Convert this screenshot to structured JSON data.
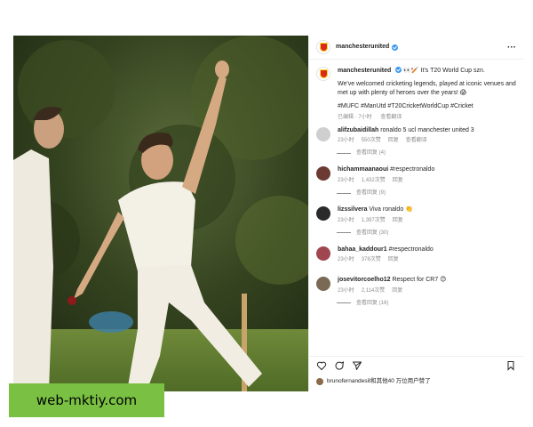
{
  "post": {
    "username": "manchesterunited",
    "more_label": "···"
  },
  "caption": {
    "username": "manchesterunited",
    "line1": "👀🏏 It's T20 World Cup szn.",
    "line2": "We've welcomed cricketing legends, played at iconic venues and met up with plenty of heroes over the years! 😱",
    "hashtags": "#MUFC #ManUtd #T20CricketWorldCup #Cricket",
    "edited": "已编辑 · 7小时",
    "see_translation": "查看翻译"
  },
  "comments": [
    {
      "username": "alifzubaidillah",
      "text": "ronaldo 5 ucl manchester united 3",
      "time": "23小时",
      "likes": "550次赞",
      "reply": "回复",
      "translate": "查看翻译",
      "replies": "查看回复 (4)",
      "avatar_color": "#cfcfcf"
    },
    {
      "username": "hichammaanaoui",
      "text": "#respectronaldo",
      "time": "23小时",
      "likes": "1,432次赞",
      "reply": "回复",
      "replies": "查看回复 (9)",
      "avatar_color": "#6b3a32"
    },
    {
      "username": "lizssilvera",
      "text": "Viva ronaldo 👏",
      "time": "23小时",
      "likes": "1,397次赞",
      "reply": "回复",
      "replies": "查看回复 (30)",
      "avatar_color": "#2a2a2a"
    },
    {
      "username": "bahaa_kaddour1",
      "text": "#respectronaldo",
      "time": "23小时",
      "likes": "378次赞",
      "reply": "回复",
      "avatar_color": "#a0464f"
    },
    {
      "username": "josevitorcoelho12",
      "text": "Respect for CR7 😊",
      "time": "23小时",
      "likes": "2,114次赞",
      "reply": "回复",
      "replies": "查看回复 (16)",
      "avatar_color": "#7a6a55"
    }
  ],
  "likes_line": "brunofernandes8和其他40 万位用户赞了",
  "watermark": "web-mktiy.com",
  "colors": {
    "link": "#00376b",
    "verified": "#3897f0",
    "watermark_bg": "#7ac143"
  }
}
